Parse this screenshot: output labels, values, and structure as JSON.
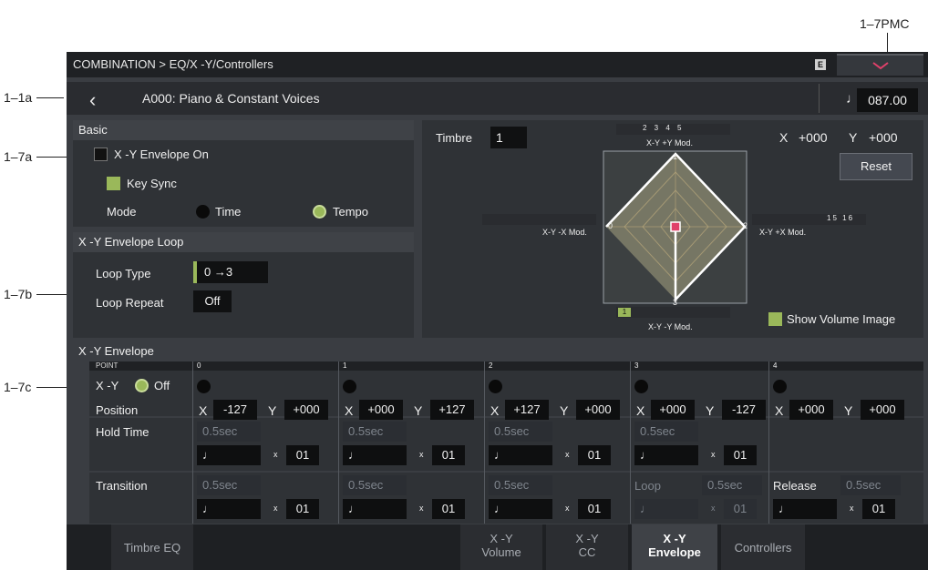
{
  "callouts": {
    "pmc": "1–7PMC",
    "a1": "1–1a",
    "a7": "1–7a",
    "b7": "1–7b",
    "c7": "1–7c"
  },
  "header": {
    "breadcrumb": "COMBINATION > EQ/X -Y/Controllers",
    "badge": "E"
  },
  "program": {
    "back_icon": "‹",
    "name": "A000: Piano & Constant Voices",
    "note_symbol": "♩",
    "tempo": "087.00"
  },
  "basic": {
    "title": "Basic",
    "xy_env_on": {
      "label": "X -Y Envelope On",
      "checked": false
    },
    "key_sync": {
      "label": "Key Sync",
      "checked": true
    },
    "mode_label": "Mode",
    "mode_time": "Time",
    "mode_tempo": "Tempo",
    "mode_selected": "Tempo"
  },
  "loop": {
    "title": "X -Y Envelope Loop",
    "type_label": "Loop Type",
    "type_value": "0 →3",
    "repeat_label": "Loop Repeat",
    "repeat_value": "Off"
  },
  "xy_view": {
    "timbre_label": "Timbre",
    "timbre_value": "1",
    "x_label": "X",
    "x_value": "+000",
    "y_label": "Y",
    "y_value": "+000",
    "reset": "Reset",
    "top_dests": "2 3 4 5",
    "plus_y": "X-Y +Y Mod.",
    "minus_x": "X-Y -X Mod.",
    "plus_x": "X-Y +X Mod.",
    "right_dests": "15 16",
    "minus_y": "X-Y -Y Mod.",
    "bottom_dest": "1",
    "point_labels": [
      "0",
      "1",
      "2",
      "3"
    ],
    "show_volume": {
      "label": "Show Volume Image",
      "checked": true
    }
  },
  "envelope": {
    "title": "X -Y Envelope",
    "point_header": "POINT",
    "xy_label": "X -Y",
    "xy_state": "Off",
    "position_label": "Position",
    "hold_label": "Hold Time",
    "transition_label": "Transition",
    "points": [
      {
        "idx": "0",
        "x": "-127",
        "y": "+000",
        "hold": "0.5sec",
        "hold_mult": "01",
        "trans": "0.5sec",
        "trans_mult": "01"
      },
      {
        "idx": "1",
        "x": "+000",
        "y": "+127",
        "hold": "0.5sec",
        "hold_mult": "01",
        "trans": "0.5sec",
        "trans_mult": "01"
      },
      {
        "idx": "2",
        "x": "+127",
        "y": "+000",
        "hold": "0.5sec",
        "hold_mult": "01",
        "trans": "0.5sec",
        "trans_mult": "01"
      },
      {
        "idx": "3",
        "x": "+000",
        "y": "-127",
        "hold": "0.5sec",
        "hold_mult": "01",
        "trans_label": "Loop",
        "trans": "0.5sec",
        "trans_mult": "01"
      },
      {
        "idx": "4",
        "x": "+000",
        "y": "+000",
        "trans_label": "Release",
        "trans": "0.5sec",
        "trans_mult": "01"
      }
    ],
    "x_letter": "X",
    "y_letter": "Y",
    "mult_sign": "x",
    "note": "♩"
  },
  "tabs": {
    "timbre_eq": "Timbre EQ",
    "xy_volume_1": "X -Y",
    "xy_volume_2": "Volume",
    "xy_cc_1": "X -Y",
    "xy_cc_2": "CC",
    "xy_env_1": "X -Y",
    "xy_env_2": "Envelope",
    "controllers": "Controllers"
  },
  "colors": {
    "accent_green": "#9ab85a",
    "background": "#3a3d42",
    "point_marker": "#e0406a"
  }
}
